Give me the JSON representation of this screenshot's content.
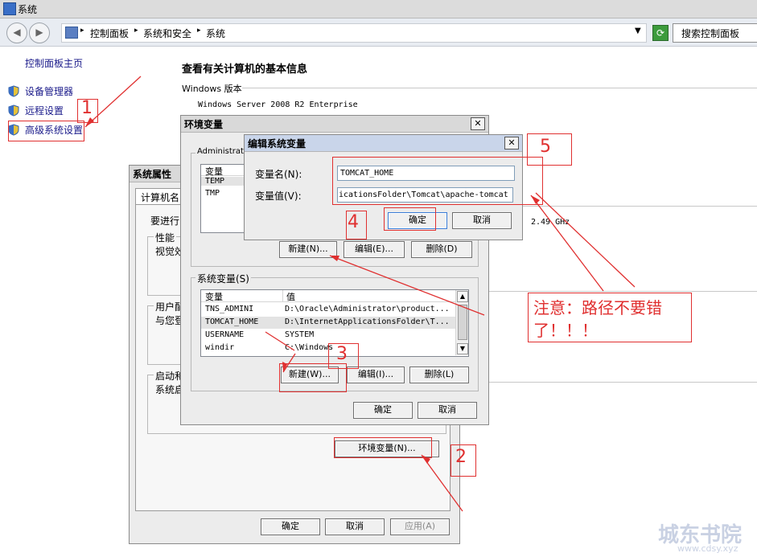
{
  "window": {
    "title": "系统"
  },
  "address": {
    "crumbs": [
      "控制面板",
      "系统和安全",
      "系统"
    ],
    "search_placeholder": "搜索控制面板"
  },
  "sidebar": {
    "home": "控制面板主页",
    "items": [
      "设备管理器",
      "远程设置",
      "高级系统设置"
    ]
  },
  "main": {
    "heading": "查看有关计算机的基本信息",
    "edition_label": "Windows 版本",
    "edition_value": "Windows Server 2008 R2 Enterprise",
    "cpu_speed": "2.49 GHz"
  },
  "sysprops": {
    "title": "系统属性",
    "tab": "计算机名",
    "text1": "要进行",
    "perf_group": "性能",
    "perf_text": "视觉效",
    "user_group": "用户配",
    "user_text": "与您登",
    "start_group": "启动和",
    "start_text": "系统启",
    "env_btn": "环境变量(N)...",
    "ok": "确定",
    "cancel": "取消",
    "apply": "应用(A)"
  },
  "envvars": {
    "title": "环境变量",
    "user_group": "Administrator",
    "col_var": "变量",
    "col_val": "值",
    "user_vars": [
      "TEMP",
      "TMP"
    ],
    "new_user": "新建(N)...",
    "edit_user": "编辑(E)...",
    "del_user": "删除(D)",
    "sys_group": "系统变量(S)",
    "sys_rows": [
      {
        "name": "TNS_ADMINI",
        "value": "D:\\Oracle\\Administrator\\product..."
      },
      {
        "name": "TOMCAT_HOME",
        "value": "D:\\InternetApplicationsFolder\\T..."
      },
      {
        "name": "USERNAME",
        "value": "SYSTEM"
      },
      {
        "name": "windir",
        "value": "C:\\Windows"
      }
    ],
    "new_sys": "新建(W)...",
    "edit_sys": "编辑(I)...",
    "del_sys": "删除(L)",
    "ok": "确定",
    "cancel": "取消"
  },
  "editvar": {
    "title": "编辑系统变量",
    "name_label": "变量名(N):",
    "name_value": "TOMCAT_HOME",
    "value_label": "变量值(V):",
    "value_value": "icationsFolder\\Tomcat\\apache-tomcat",
    "ok": "确定",
    "cancel": "取消"
  },
  "annotations": {
    "n1": "1",
    "n2": "2",
    "n3": "3",
    "n4": "4",
    "n5": "5",
    "note": "注意：路径不要错了！！！",
    "color": "#e03030"
  },
  "watermark": {
    "name": "城东书院",
    "url": "www.cdsy.xyz"
  }
}
